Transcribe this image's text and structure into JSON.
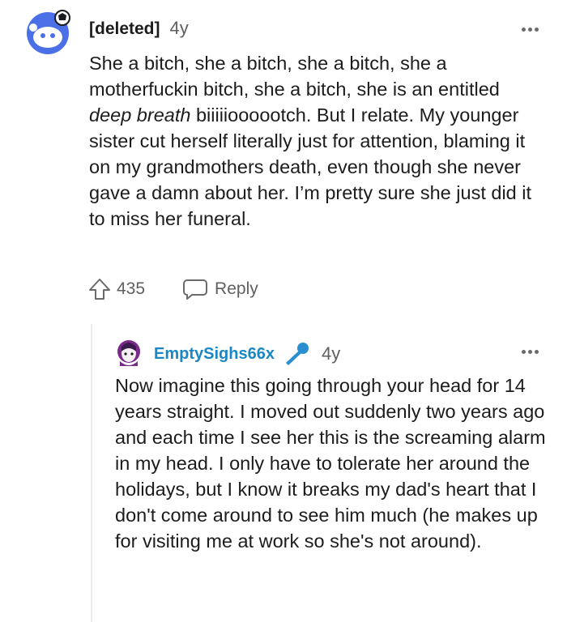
{
  "comment": {
    "author": "[deleted]",
    "age": "4y",
    "text_before": "She a bitch, she a bitch, she a bitch, she a motherfuckin bitch, she a bitch, she is an entitled ",
    "text_italic": "deep breath",
    "text_after": " biiiiioooootch. But I relate. My younger sister cut herself literally just for attention, blaming it on my grandmothers death, even though she never gave a damn about her. I’m pretty sure she just did it to miss her funeral.",
    "upvotes": "435",
    "reply_label": "Reply"
  },
  "reply": {
    "author": "EmptySighs66x",
    "age": "4y",
    "text": "Now imagine this going through your head for 14 years straight. I moved out suddenly two years ago and each time I see her this is the screaming alarm in my head. I only have to tolerate her around the holidays, but I know it breaks my dad's heart that I don't come around to see him much (he makes up for visiting me at work so she's not around)."
  },
  "colors": {
    "author_link": "#1a87c4",
    "muted": "#5f5f5f",
    "avatar_bg": "#4b6fe6"
  }
}
